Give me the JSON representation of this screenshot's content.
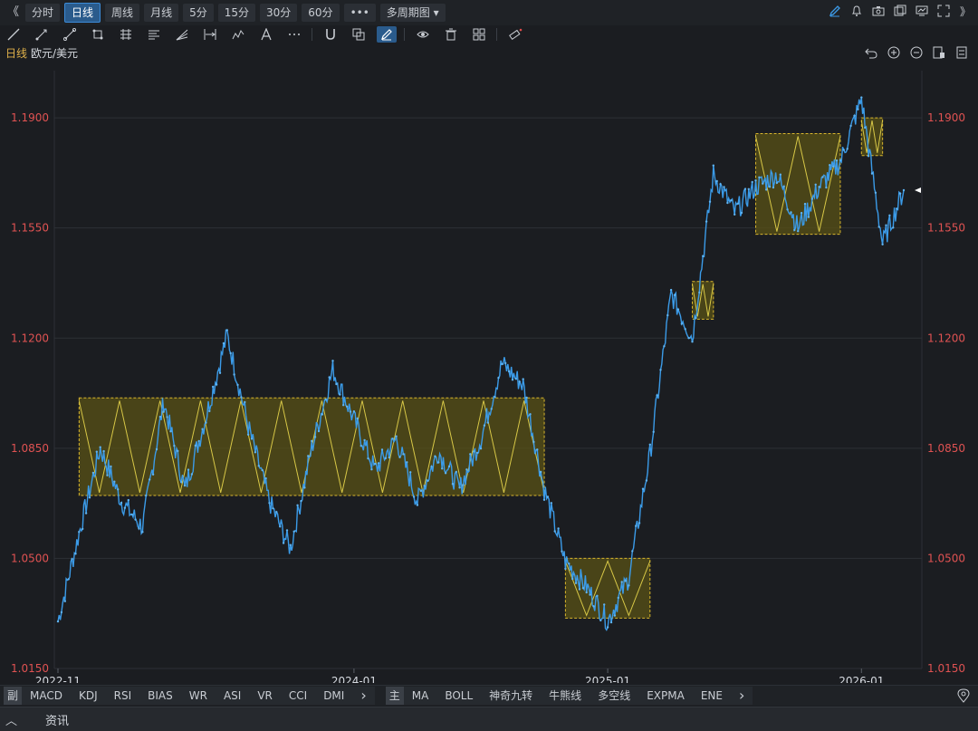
{
  "toolbar": {
    "collapse": "《",
    "periods": [
      "分时",
      "日线",
      "周线",
      "月线",
      "5分",
      "15分",
      "30分",
      "60分"
    ],
    "active_period": "日线",
    "more": "•••",
    "multi": "多周期图 ▾",
    "expand": "》",
    "right_icons": [
      "pen-icon",
      "bell-icon",
      "camera-icon",
      "window-icon",
      "screen-icon",
      "fullscreen-icon"
    ]
  },
  "draw_tools": [
    "line-tool-icon",
    "ray-tool-icon",
    "segment-tool-icon",
    "rect-tool-icon",
    "fib-tool-icon",
    "channel-tool-icon",
    "fan-tool-icon",
    "range-tool-icon",
    "wave-tool-icon",
    "text-tool-icon",
    "more-tools-icon",
    "magnet-icon",
    "copy-icon",
    "brush-icon",
    "eye-icon",
    "trash-icon",
    "layers-icon",
    "ruler-icon"
  ],
  "chart_info": {
    "period": "日线",
    "symbol": "欧元/美元"
  },
  "chart_data": {
    "type": "line",
    "title": "",
    "y_ticks": [
      "1.1900",
      "1.1550",
      "1.1200",
      "1.0850",
      "1.0500",
      "1.0150"
    ],
    "x_ticks": [
      "2022-11",
      "2024-01",
      "2025-01",
      "2026-01"
    ],
    "ylim": [
      1.015,
      1.205
    ],
    "series": [
      {
        "x": [
          "2022-11",
          "2022-12",
          "2023-01",
          "2023-02",
          "2023-03",
          "2023-04",
          "2023-05",
          "2023-06",
          "2023-07",
          "2023-08",
          "2023-09",
          "2023-10",
          "2023-11",
          "2023-12",
          "2024-01",
          "2024-02",
          "2024-03",
          "2024-04",
          "2024-05",
          "2024-06",
          "2024-07",
          "2024-08",
          "2024-09",
          "2024-10",
          "2024-11",
          "2024-12",
          "2025-01",
          "2025-02",
          "2025-03",
          "2025-04",
          "2025-05",
          "2025-06",
          "2025-07",
          "2025-08",
          "2025-09",
          "2025-10",
          "2025-11",
          "2025-12",
          "2026-01",
          "2026-02",
          "2026-03"
        ],
        "values": [
          1.03,
          1.058,
          1.085,
          1.068,
          1.06,
          1.1,
          1.072,
          1.095,
          1.121,
          1.092,
          1.068,
          1.053,
          1.085,
          1.11,
          1.094,
          1.078,
          1.088,
          1.068,
          1.084,
          1.072,
          1.088,
          1.112,
          1.105,
          1.072,
          1.049,
          1.041,
          1.03,
          1.044,
          1.083,
          1.134,
          1.12,
          1.172,
          1.16,
          1.168,
          1.172,
          1.155,
          1.168,
          1.176,
          1.196,
          1.15,
          1.167
        ]
      }
    ],
    "zones": [
      {
        "x0": "2022-12",
        "x1": "2024-10",
        "y0": 1.07,
        "y1": 1.101
      },
      {
        "x0": "2024-11",
        "x1": "2025-03",
        "y0": 1.031,
        "y1": 1.05
      },
      {
        "x0": "2025-05",
        "x1": "2025-06",
        "y0": 1.126,
        "y1": 1.138
      },
      {
        "x0": "2025-08",
        "x1": "2025-12",
        "y0": 1.153,
        "y1": 1.185
      },
      {
        "x0": "2026-01",
        "x1": "2026-02",
        "y0": 1.178,
        "y1": 1.19
      }
    ],
    "last_price_marker": 1.167,
    "grid": true
  },
  "chart_controls": [
    "undo-icon",
    "zoom-in-icon",
    "zoom-out-icon",
    "layout-icon",
    "settings-icon"
  ],
  "indicators": {
    "sub_tag": "副",
    "sub": [
      "MACD",
      "KDJ",
      "RSI",
      "BIAS",
      "WR",
      "ASI",
      "VR",
      "CCI",
      "DMI"
    ],
    "main_tag": "主",
    "main": [
      "MA",
      "BOLL",
      "神奇九转",
      "牛熊线",
      "多空线",
      "EXPMA",
      "ENE"
    ],
    "next": "›"
  },
  "news": {
    "collapse": "︿",
    "label": "资讯"
  },
  "colors": {
    "price_line": "#3b9be8",
    "zone_fill": "#5a5116",
    "zone_border": "#d9b62d",
    "zigzag": "#d8c847",
    "grid": "#2c3036",
    "tick_text": "#e05252"
  }
}
